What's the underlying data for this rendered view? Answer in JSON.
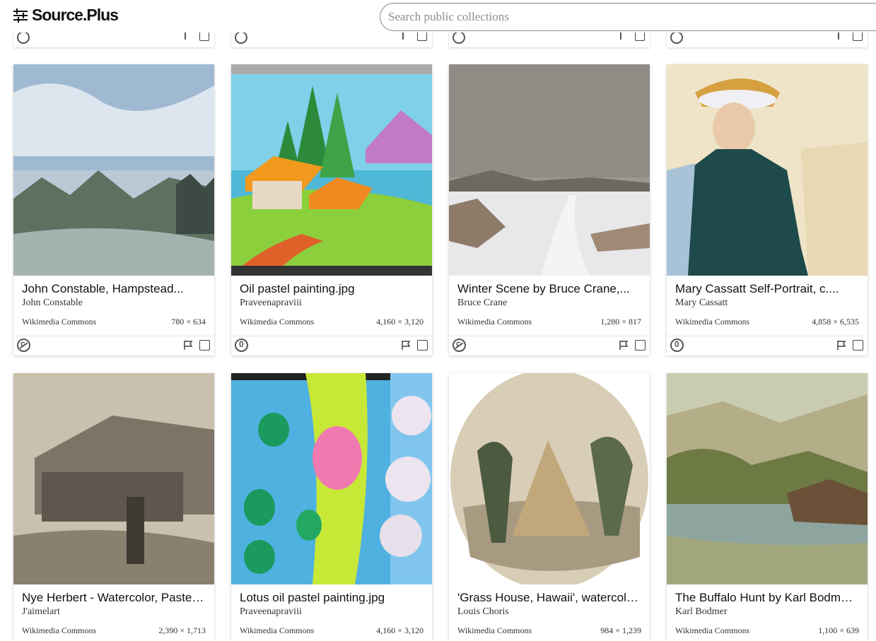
{
  "header": {
    "logo_text": "Source.Plus",
    "search_placeholder": "Search public collections"
  },
  "cards": [
    {
      "title": "John Constable, Hampstead...",
      "author": "John Constable",
      "source": "Wikimedia Commons",
      "dimensions": "780 × 634",
      "license": "public-domain-icon"
    },
    {
      "title": "Oil pastel painting.jpg",
      "author": "Praveenapraviii",
      "source": "Wikimedia Commons",
      "dimensions": "4,160 × 3,120",
      "license": "cc0-icon"
    },
    {
      "title": "Winter Scene by Bruce Crane,...",
      "author": "Bruce Crane",
      "source": "Wikimedia Commons",
      "dimensions": "1,280 × 817",
      "license": "public-domain-icon"
    },
    {
      "title": "Mary Cassatt Self-Portrait, c....",
      "author": "Mary Cassatt",
      "source": "Wikimedia Commons",
      "dimensions": "4,858 × 6,535",
      "license": "cc0-icon"
    },
    {
      "title": "Nye Herbert - Watercolor, Pastel ...",
      "author": "J'aimelart",
      "source": "Wikimedia Commons",
      "dimensions": "2,390 × 1,713"
    },
    {
      "title": "Lotus oil pastel painting.jpg",
      "author": "Praveenapraviii",
      "source": "Wikimedia Commons",
      "dimensions": "4,160 × 3,120"
    },
    {
      "title": "'Grass House, Hawaii', watercolo...",
      "author": "Louis Choris",
      "source": "Wikimedia Commons",
      "dimensions": "984 × 1,239"
    },
    {
      "title": "The Buffalo Hunt by Karl Bodmer,...",
      "author": "Karl Bodmer",
      "source": "Wikimedia Commons",
      "dimensions": "1,100 × 639"
    }
  ]
}
